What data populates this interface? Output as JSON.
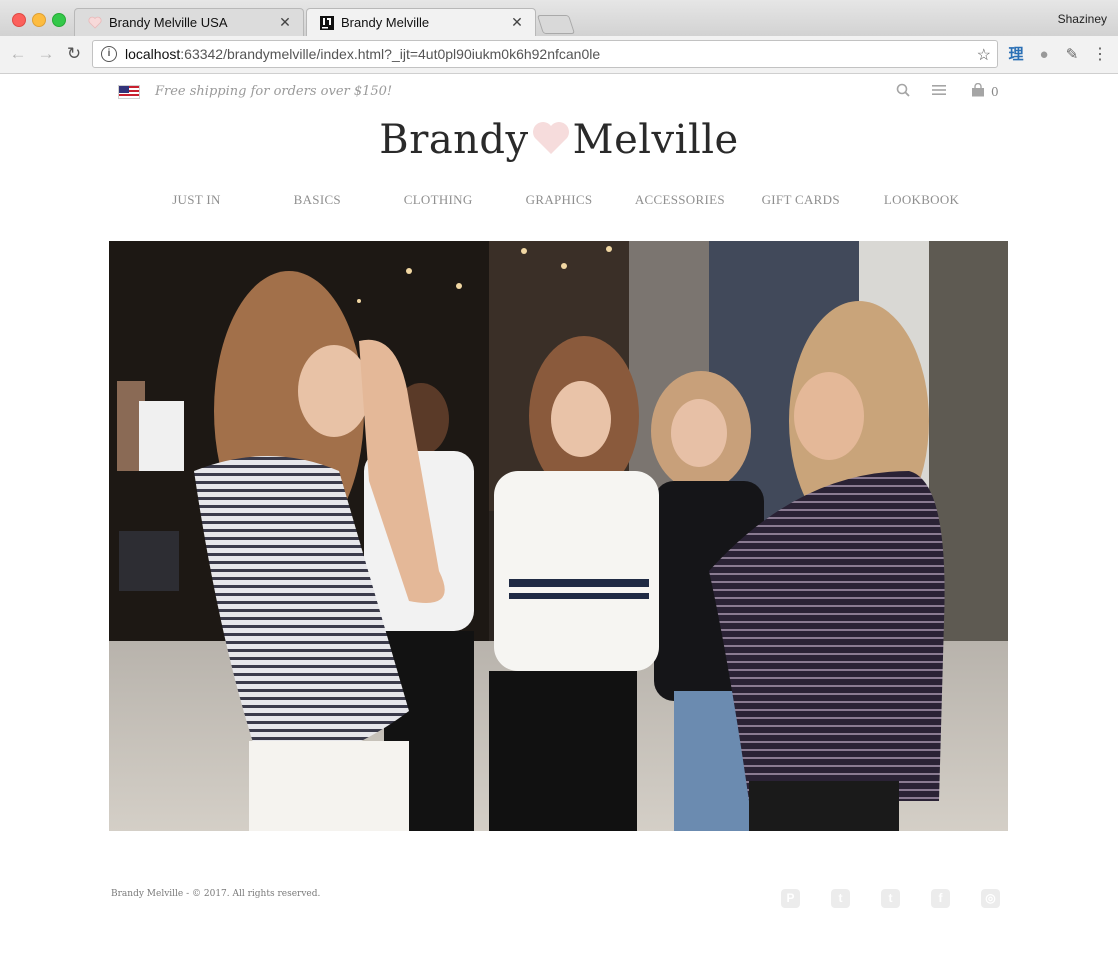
{
  "browser": {
    "tabs": [
      {
        "label": "Brandy Melville USA",
        "favicon": "heart-icon"
      },
      {
        "label": "Brandy Melville",
        "favicon": "intellij-icon",
        "active": true
      }
    ],
    "profile": "Shaziney",
    "url_host": "localhost",
    "url_rest": ":63342/brandymelville/index.html?_ijt=4ut0pl90iukm0k6h92nfcan0le"
  },
  "header": {
    "shipping_notice": "Free shipping for orders over $150!",
    "cart_count": "0",
    "logo_left": "Brandy",
    "logo_right": "Melville"
  },
  "nav": {
    "items": [
      "JUST IN",
      "BASICS",
      "CLOTHING",
      "GRAPHICS",
      "ACCESSORIES",
      "GIFT CARDS",
      "LOOKBOOK"
    ]
  },
  "footer": {
    "copyright": "Brandy Melville - © 2017. All rights reserved.",
    "social": [
      "pinterest-icon",
      "twitter-icon",
      "tumblr-icon",
      "facebook-icon",
      "instagram-icon"
    ]
  },
  "colors": {
    "heart": "#f6dcdc",
    "nav_text": "#8f8f8f"
  }
}
